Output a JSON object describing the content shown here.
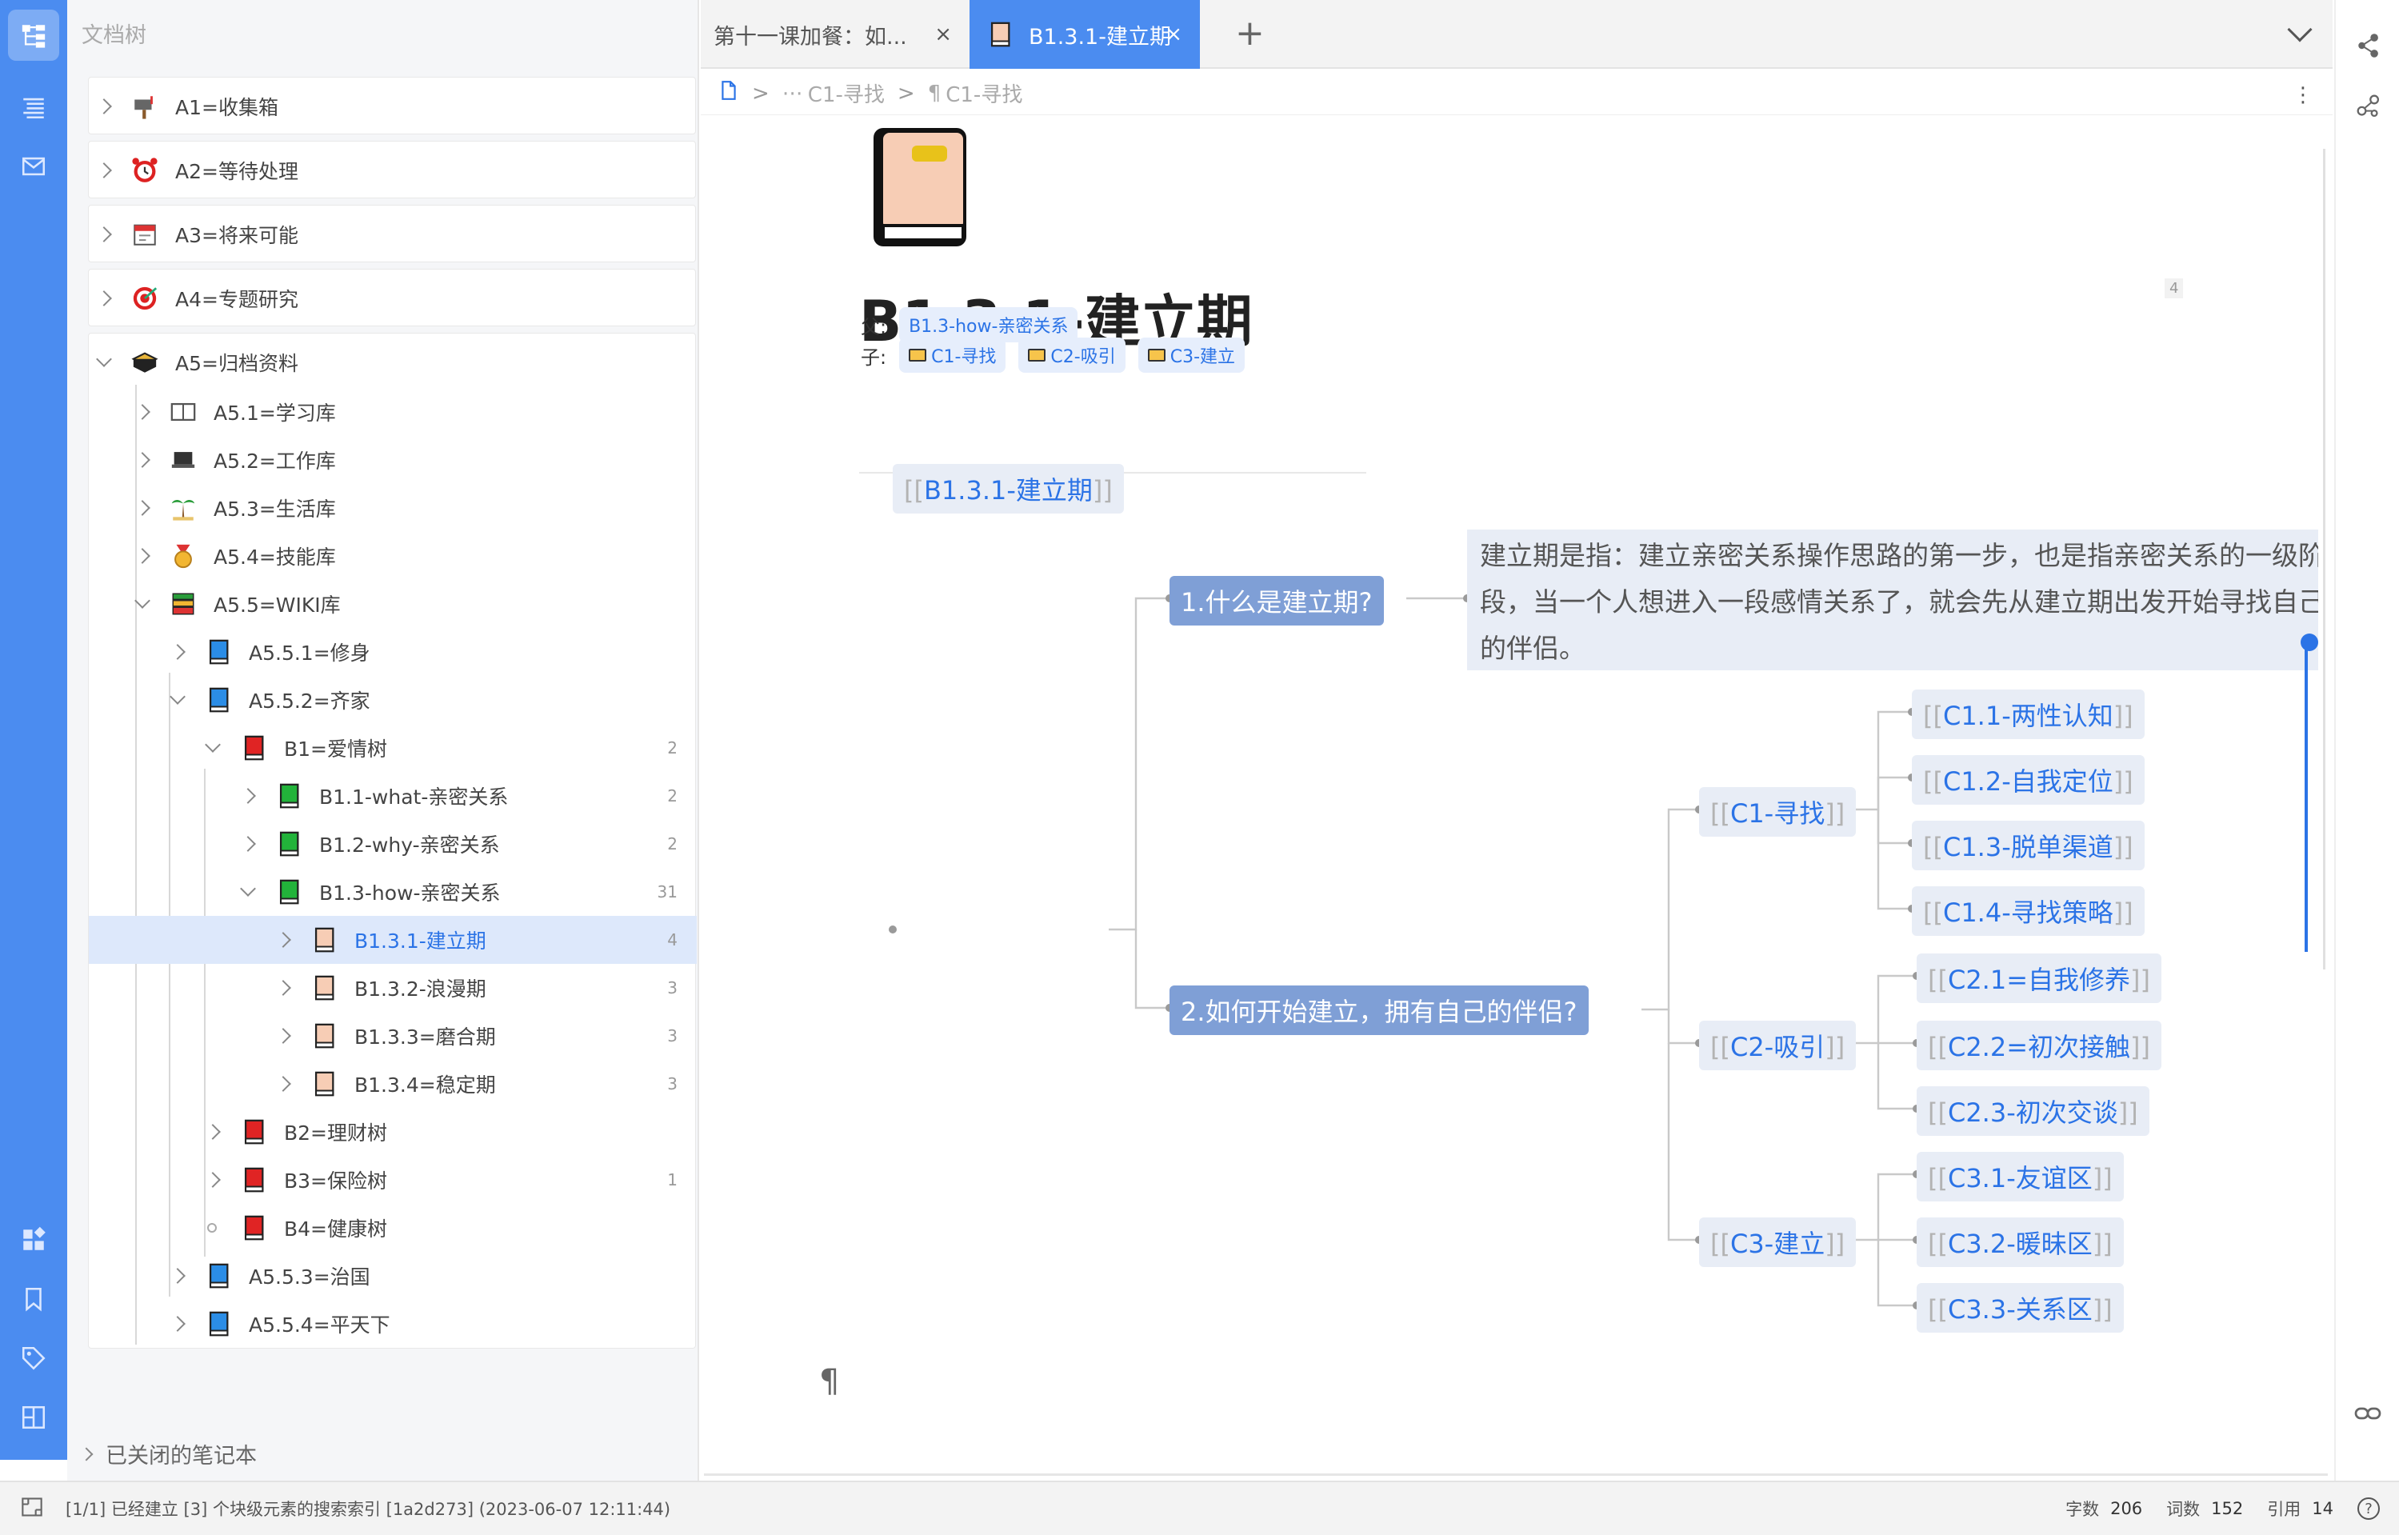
{
  "dock": {
    "title": "文档树",
    "closed_notebooks": "已关闭的笔记本"
  },
  "notebooks": [
    {
      "label": "A1=收集箱",
      "icon": "mailbox-icon"
    },
    {
      "label": "A2=等待处理",
      "icon": "alarm-clock-icon"
    },
    {
      "label": "A3=将来可能",
      "icon": "calendar-icon"
    },
    {
      "label": "A4=专题研究",
      "icon": "target-icon"
    },
    {
      "label": "A5=归档资料",
      "icon": "archive-box-icon"
    }
  ],
  "tree": [
    {
      "label": "A5.1=学习库",
      "icon": "book-open-icon",
      "count": ""
    },
    {
      "label": "A5.2=工作库",
      "icon": "laptop-icon",
      "count": ""
    },
    {
      "label": "A5.3=生活库",
      "icon": "palm-tree-icon",
      "count": ""
    },
    {
      "label": "A5.4=技能库",
      "icon": "medal-icon",
      "count": ""
    },
    {
      "label": "A5.5=WIKI库",
      "icon": "books-icon",
      "count": ""
    },
    {
      "label": "A5.5.1=修身",
      "icon": "blue-book-icon",
      "count": ""
    },
    {
      "label": "A5.5.2=齐家",
      "icon": "blue-book-icon",
      "count": ""
    },
    {
      "label": "B1=爱情树",
      "icon": "red-book-icon",
      "count": "2"
    },
    {
      "label": "B1.1-what-亲密关系",
      "icon": "green-book-icon",
      "count": "2"
    },
    {
      "label": "B1.2-why-亲密关系",
      "icon": "green-book-icon",
      "count": "2"
    },
    {
      "label": "B1.3-how-亲密关系",
      "icon": "green-book-icon",
      "count": "31"
    },
    {
      "label": "B1.3.1-建立期",
      "icon": "peach-book-icon",
      "count": "4"
    },
    {
      "label": "B1.3.2-浪漫期",
      "icon": "peach-book-icon",
      "count": "3"
    },
    {
      "label": "B1.3.3=磨合期",
      "icon": "peach-book-icon",
      "count": "3"
    },
    {
      "label": "B1.3.4=稳定期",
      "icon": "peach-book-icon",
      "count": "3"
    },
    {
      "label": "B2=理财树",
      "icon": "red-book-icon",
      "count": ""
    },
    {
      "label": "B3=保险树",
      "icon": "red-book-icon",
      "count": "1"
    },
    {
      "label": "B4=健康树",
      "icon": "red-book-icon",
      "count": ""
    },
    {
      "label": "A5.5.3=治国",
      "icon": "blue-book-icon",
      "count": ""
    },
    {
      "label": "A5.5.4=平天下",
      "icon": "blue-book-icon",
      "count": ""
    }
  ],
  "tabs": [
    {
      "label": "第十一课加餐：如...",
      "close": "×"
    },
    {
      "label": "B1.3.1-建立期",
      "close": "×"
    }
  ],
  "tab_add": "+",
  "breadcrumb": {
    "item1": "C1-寻找",
    "item2": "C1-寻找",
    "more": "⋮"
  },
  "doc": {
    "title": "B1.3.1-建立期",
    "ref_count": "4",
    "parent_label": "父:",
    "parent": "B1.3-how-亲密关系",
    "children_label": "子:",
    "children": [
      "C1-寻找",
      "C2-吸引",
      "C3-建立"
    ],
    "para_mark": "¶"
  },
  "mindmap": {
    "root": "B1.3.1-建立期",
    "q1": "1.什么是建立期?",
    "q1_text": "建立期是指：建立亲密关系操作思路的第一步，也是指亲密关系的一级阶段，当一个人想进入一段感情关系了，就会先从建立期出发开始寻找自己的伴侣。",
    "q2": "2.如何开始建立，拥有自己的伴侣?",
    "c1": "C1-寻找",
    "c1_children": [
      "C1.1-两性认知",
      "C1.2-自我定位",
      "C1.3-脱单渠道",
      "C1.4-寻找策略"
    ],
    "c2": "C2-吸引",
    "c2_children": [
      "C2.1=自我修养",
      "C2.2=初次接触",
      "C2.3-初次交谈"
    ],
    "c3": "C3-建立",
    "c3_children": [
      "C3.1-友谊区",
      "C3.2-暖昧区",
      "C3.3-关系区"
    ],
    "bracket_open": "[[",
    "bracket_close": "]]"
  },
  "status": {
    "message": "[1/1] 已经建立 [3] 个块级元素的搜索索引 [1a2d273] (2023-06-07 12:11:44)",
    "chars_label": "字数",
    "chars": "206",
    "words_label": "词数",
    "words": "152",
    "refs_label": "引用",
    "refs": "14",
    "help": "?"
  },
  "colors": {
    "accent": "#4b8cf0",
    "link": "#2b73e6",
    "mindmap_l1": "#7f9fd6",
    "mindmap_node": "#e8edf6"
  }
}
